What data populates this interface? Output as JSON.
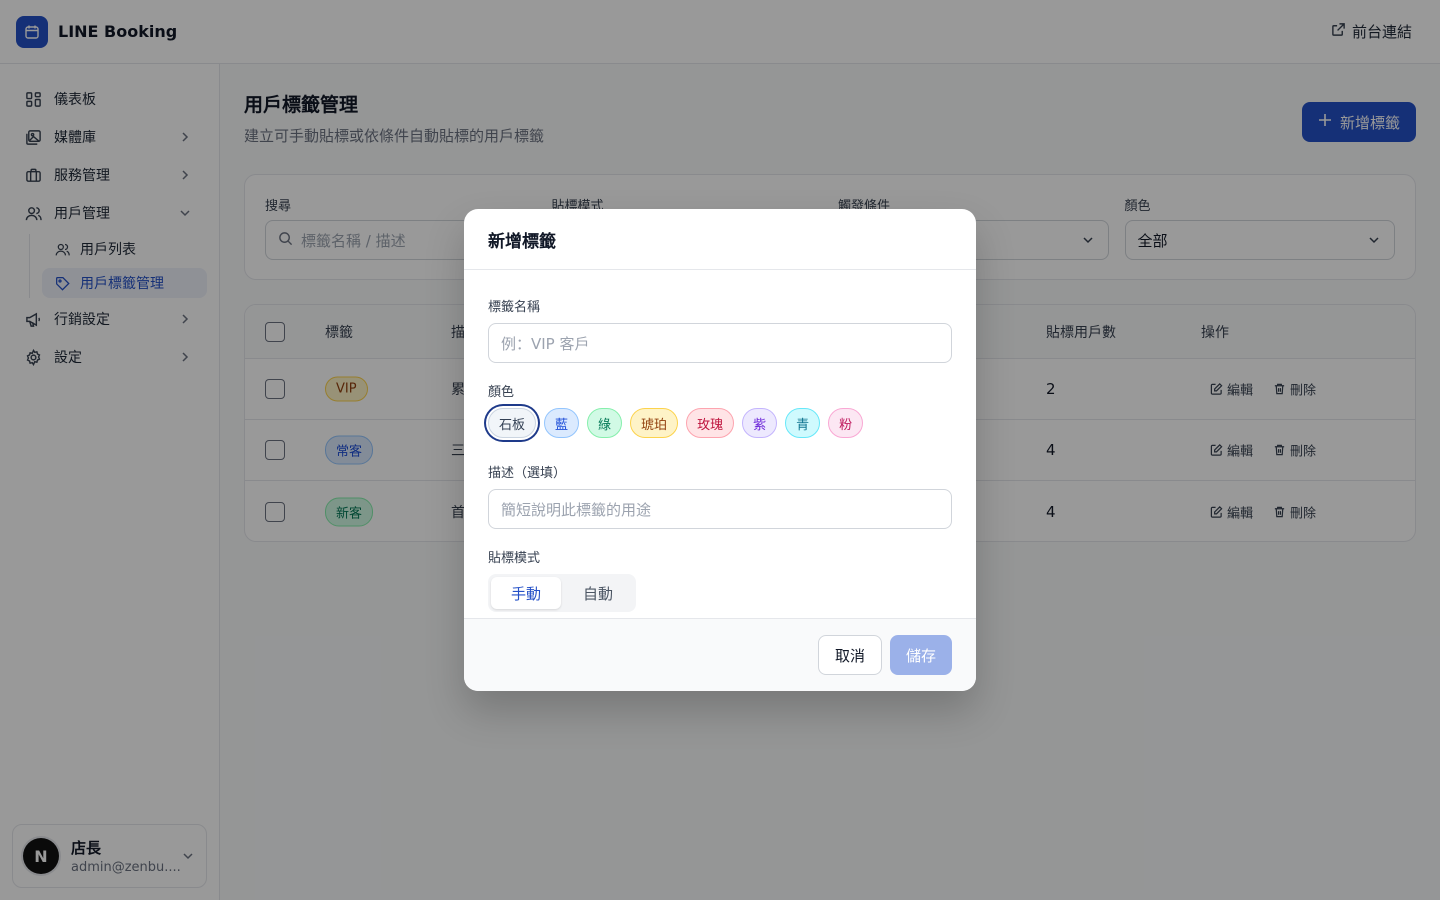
{
  "app": {
    "brand": "LINE Booking",
    "front_link": "前台連結"
  },
  "sidebar": {
    "items": [
      {
        "label": "儀表板",
        "icon": "dashboard-icon"
      },
      {
        "label": "媒體庫",
        "icon": "media-icon"
      },
      {
        "label": "服務管理",
        "icon": "briefcase-icon"
      },
      {
        "label": "用戶管理",
        "icon": "users-icon"
      },
      {
        "label": "用戶列表",
        "icon": "users-icon"
      },
      {
        "label": "用戶標籤管理",
        "icon": "tag-icon"
      },
      {
        "label": "行銷設定",
        "icon": "megaphone-icon"
      },
      {
        "label": "設定",
        "icon": "gear-icon"
      }
    ],
    "user": {
      "avatar": "N",
      "name": "店長",
      "email": "admin@zenbu...."
    }
  },
  "page": {
    "title": "用戶標籤管理",
    "subtitle": "建立可手動貼標或依條件自動貼標的用戶標籤",
    "add_button": "新增標籤"
  },
  "filters": {
    "search_label": "搜尋",
    "search_placeholder": "標籤名稱 / 描述",
    "mode_label": "貼標模式",
    "trigger_label": "觸發條件",
    "color_label": "顏色",
    "color_value": "全部"
  },
  "table": {
    "headers": {
      "tag": "標籤",
      "desc": "描述",
      "count": "貼標用戶數",
      "actions": "操作"
    },
    "rows": [
      {
        "tag": "VIP",
        "desc": "累",
        "count": "2",
        "color": "#b45309"
      },
      {
        "tag": "常客",
        "desc": "三",
        "count": "4",
        "color": "#1d4ed8"
      },
      {
        "tag": "新客",
        "desc": "首",
        "count": "4",
        "color": "#047857"
      }
    ],
    "edit_label": "編輯",
    "delete_label": "刪除"
  },
  "modal": {
    "title": "新增標籤",
    "name_label": "標籤名稱",
    "name_placeholder": "例：VIP 客戶",
    "color_label": "顏色",
    "colors": [
      {
        "label": "石板",
        "bg": "#f1f5f9",
        "border": "#cbd5e1",
        "text": "#334155",
        "selected": true
      },
      {
        "label": "藍",
        "bg": "#dbeafe",
        "border": "#93c5fd",
        "text": "#1d4ed8"
      },
      {
        "label": "綠",
        "bg": "#d1fae5",
        "border": "#86efac",
        "text": "#047857"
      },
      {
        "label": "琥珀",
        "bg": "#fef3c7",
        "border": "#fcd34d",
        "text": "#92400e"
      },
      {
        "label": "玫瑰",
        "bg": "#ffe4e6",
        "border": "#fda4af",
        "text": "#be123c"
      },
      {
        "label": "紫",
        "bg": "#ede9fe",
        "border": "#c4b5fd",
        "text": "#6d28d9"
      },
      {
        "label": "青",
        "bg": "#cffafe",
        "border": "#67e8f9",
        "text": "#0e7490"
      },
      {
        "label": "粉",
        "bg": "#fce7f3",
        "border": "#f9a8d4",
        "text": "#be185d"
      }
    ],
    "desc_label": "描述（選填）",
    "desc_placeholder": "簡短說明此標籤的用途",
    "mode_label": "貼標模式",
    "mode_manual": "手動",
    "mode_auto": "自動",
    "cancel": "取消",
    "save": "儲存"
  }
}
